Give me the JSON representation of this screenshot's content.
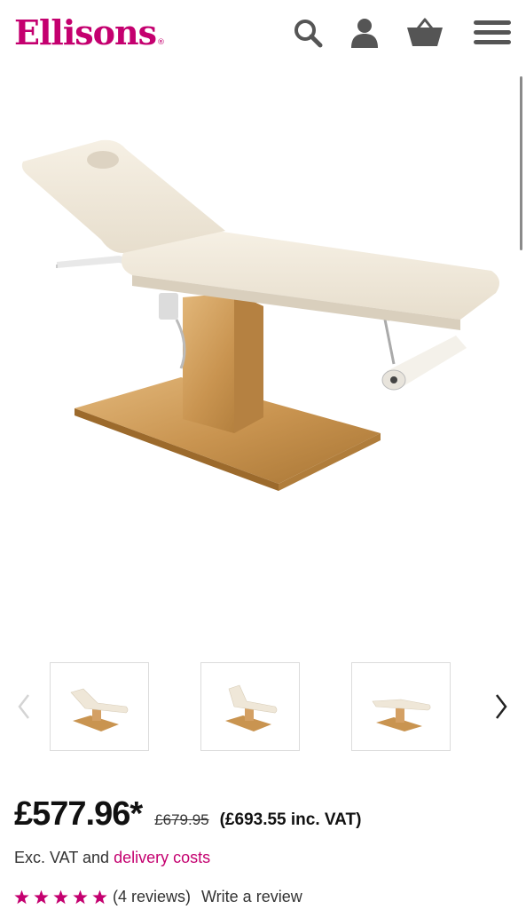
{
  "header": {
    "logo_text": "Ellisons",
    "logo_mark": "®",
    "icons": [
      "search-icon",
      "account-icon",
      "basket-icon",
      "menu-icon"
    ],
    "brand_color": "#c4006f"
  },
  "gallery": {
    "main_image": "electric massage couch with beige cushions, gold base and paper roll",
    "thumbnail_count": 3,
    "prev_icon": "chevron-left-icon",
    "next_icon": "chevron-right-icon"
  },
  "product": {
    "price": "£577.96*",
    "old_price": "£679.95",
    "inc_vat": "(£693.55 inc. VAT)",
    "vat_text_prefix": "Exc. VAT and",
    "vat_link": "delivery costs",
    "rating": 5,
    "reviews_text": "(4 reviews)",
    "write_review": "Write a review",
    "star_color": "#c4006f"
  }
}
